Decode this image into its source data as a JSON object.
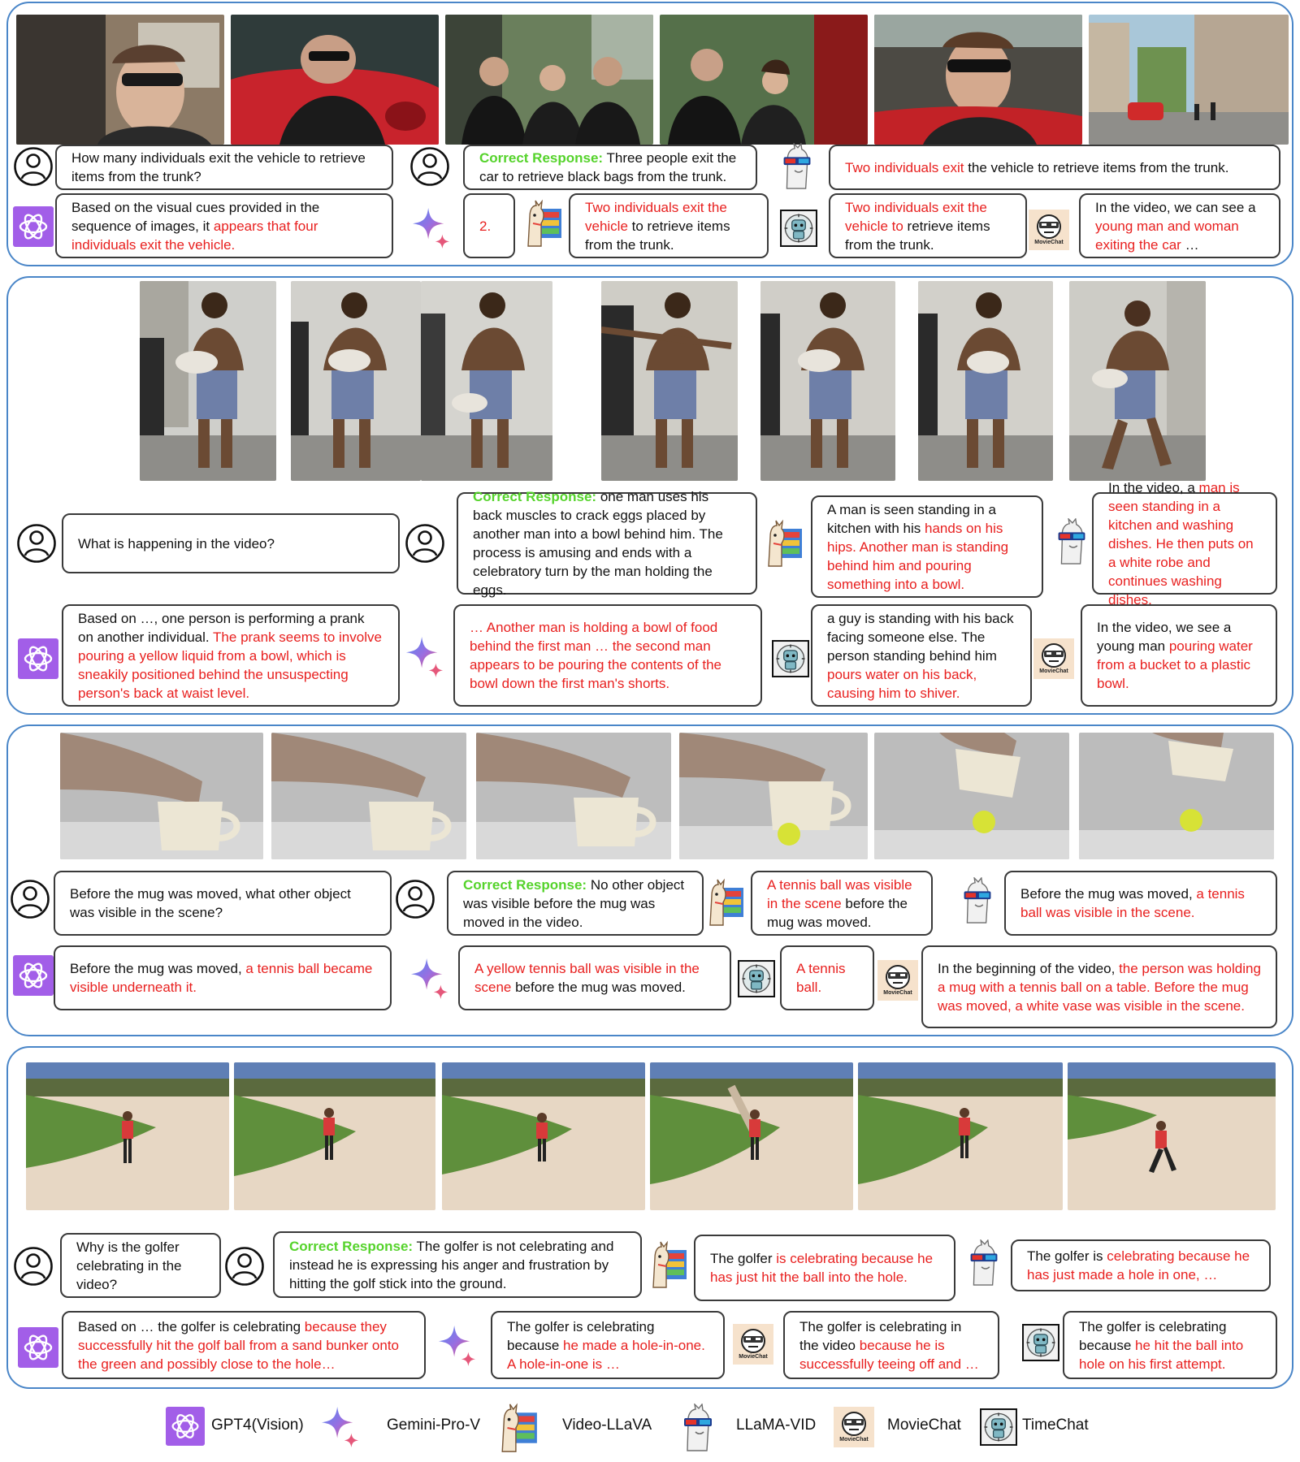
{
  "panels": [
    {
      "question": "How many individuals exit the vehicle to retrieve items from the trunk?",
      "correct_label": "Correct Response:",
      "correct_text": "Three people exit the car to retrieve black bags from the trunk.",
      "llamavid_r1": "Two individuals exit",
      "llamavid_b1": " the vehicle to retrieve items from the trunk.",
      "gpt4_b1": "Based on the visual cues provided in the sequence of images, it ",
      "gpt4_r1": "appears that four individuals exit the vehicle.",
      "gemini_r1": "2.",
      "videollava_r1": "Two individuals exit the vehicle",
      "videollava_b1": " to retrieve items from the trunk.",
      "timechat_r1": "Two individuals exit the vehicle to",
      "timechat_b1": " retrieve items from the trunk.",
      "moviechat_b1": "In the video, we can see a ",
      "moviechat_r1": "young man and woman exiting the car",
      "moviechat_b2": " …"
    },
    {
      "question": "What is happening in the video?",
      "correct_label": "Correct Response:",
      "correct_text": "one man uses his back muscles to crack eggs placed by another man into a bowl behind him. The process is amusing and ends with a celebratory turn by the man holding the eggs.",
      "videollava_b1": "A man is seen standing in a kitchen with his ",
      "videollava_r1": "hands on his hips. Another man is standing behind him and pouring something into a bowl.",
      "llamavid_b1": "In the video, a ",
      "llamavid_r1": "man is seen standing in a kitchen and washing dishes. He then puts on a white robe and continues washing dishes.",
      "gpt4_b1": "Based on  …, one person is performing a prank on another individual. ",
      "gpt4_r1": "The prank seems to involve pouring a yellow liquid from a bowl, which is sneakily positioned behind the unsuspecting person's back at waist level.",
      "gemini_r1": "… Another man is holding a bowl of food behind the first man … the second man appears to be pouring the contents of the bowl down the first man's shorts.",
      "timechat_b1": "a guy is standing with his back facing someone else. The person standing behind him ",
      "timechat_r1": "pours water on his back, causing him to shiver.",
      "moviechat_b1": "In the video, we see a young man ",
      "moviechat_r1": "pouring water from a bucket to a plastic bowl."
    },
    {
      "question": "Before the mug was moved, what other object was visible in the scene?",
      "correct_label": "Correct Response:",
      "correct_text": "No other object was visible before the mug was moved in the video.",
      "videollava_r1": "A tennis ball was visible in the scene",
      "videollava_b1": " before the mug was moved.",
      "llamavid_b1": "Before the mug was moved, ",
      "llamavid_r1": "a tennis ball was visible in the scene.",
      "gpt4_b1": "Before the mug was moved, ",
      "gpt4_r1": "a tennis ball became visible underneath it.",
      "gemini_r1": "A yellow tennis ball was visible in the scene",
      "gemini_b1": " before the mug was moved.",
      "timechat_r1": "A tennis ball.",
      "moviechat_b1": "In the beginning of the video, ",
      "moviechat_r1": "the person was holding a mug with a tennis ball on a table. Before the mug was moved, a white vase was visible in the scene."
    },
    {
      "question": "Why is the golfer celebrating in the video?",
      "correct_label": "Correct Response:",
      "correct_text": "The golfer is not celebrating and instead he is expressing his anger and frustration by hitting the golf stick into the ground.",
      "videollava_b1": "The golfer ",
      "videollava_r1": "is celebrating because he has just hit the ball into the hole.",
      "llamavid_b1": "The golfer is ",
      "llamavid_r1": "celebrating because he has just made a hole in one, …",
      "gpt4_b1": "Based on … the golfer is celebrating ",
      "gpt4_r1": "because they successfully hit the golf ball from a sand bunker onto the green and possibly close to the hole…",
      "gemini_b1": "The golfer is celebrating because ",
      "gemini_r1": "he made a hole-in-one. A hole-in-one is …",
      "moviechat_b1": "The golfer is celebrating in the video ",
      "moviechat_r1": "because he is successfully teeing off and …",
      "timechat_b1": "The golfer is celebrating because ",
      "timechat_r1": "he hit the ball into hole on his first attempt."
    }
  ],
  "legend": {
    "gpt4": "GPT4(Vision)",
    "gemini": "Gemini-Pro-V",
    "videollava": "Video-LLaVA",
    "llamavid": "LLaMA-VID",
    "moviechat": "MovieChat",
    "timechat": "TimeChat"
  },
  "icon_text": {
    "moviechat": "MovieChat"
  },
  "colors": {
    "panel_border": "#4a86c8",
    "wrong": "#e8201f",
    "correct": "#55d32b",
    "gpt": "#a25ee8"
  }
}
